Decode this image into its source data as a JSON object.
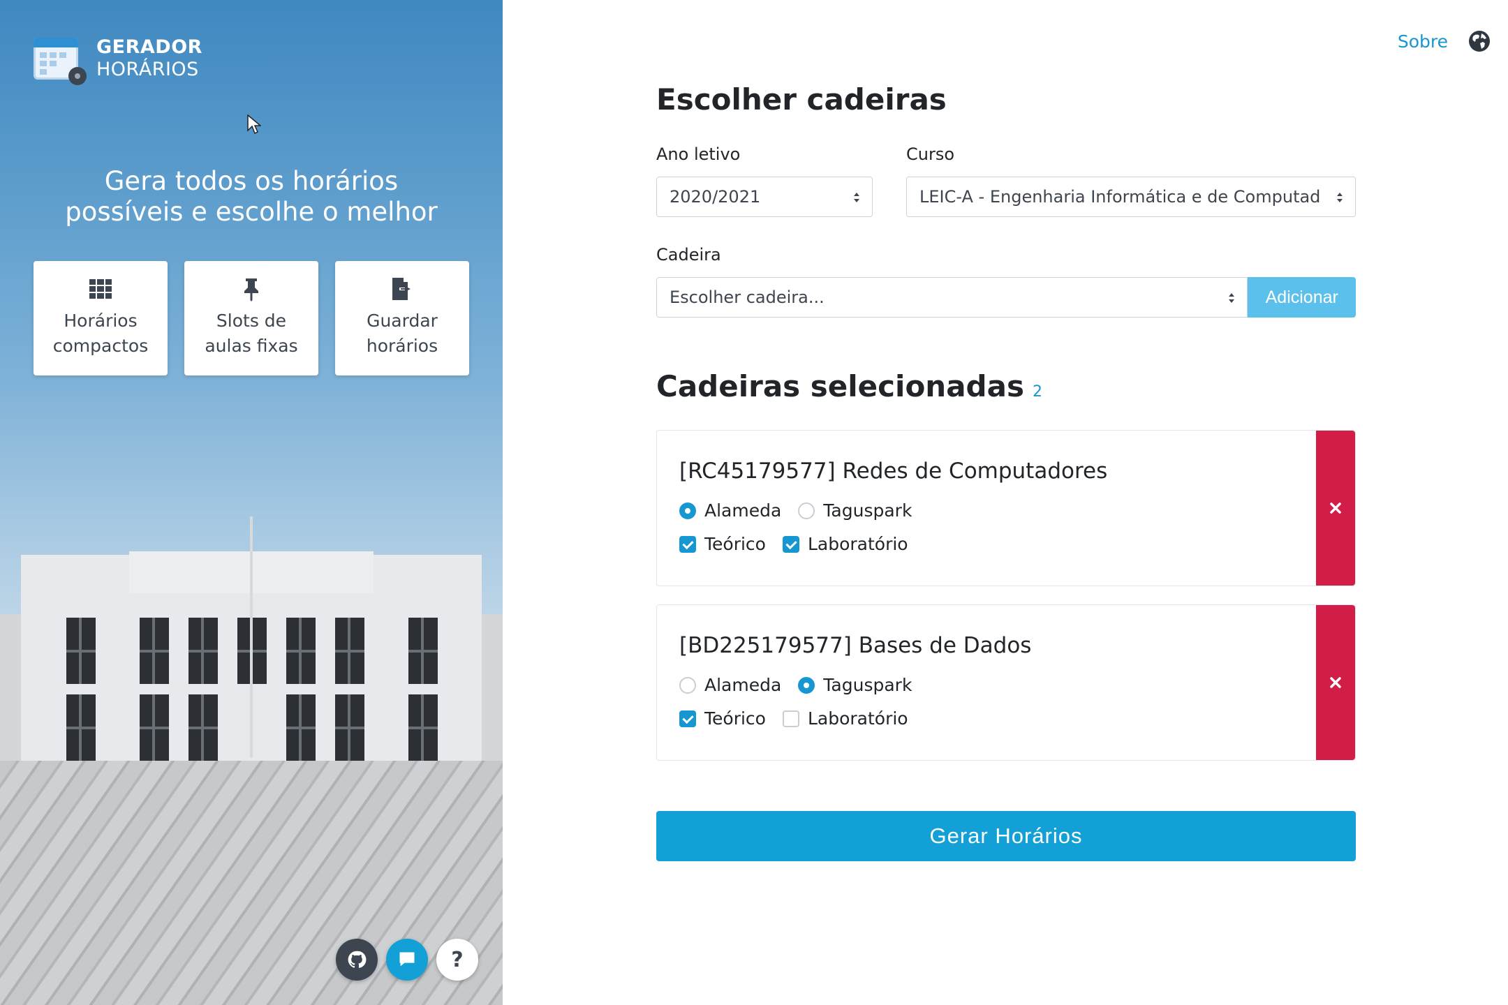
{
  "brand": {
    "line1": "GERADOR",
    "line2": "HORÁRIOS"
  },
  "tagline": {
    "line1": "Gera todos os horários",
    "line2": "possíveis e escolhe o melhor"
  },
  "features": [
    {
      "icon": "grid-icon",
      "line1": "Horários",
      "line2": "compactos"
    },
    {
      "icon": "pin-icon",
      "line1": "Slots de",
      "line2": "aulas fixas"
    },
    {
      "icon": "file-export-icon",
      "line1": "Guardar",
      "line2": "horários"
    }
  ],
  "fabs": {
    "github_icon": "github-icon",
    "chat_icon": "chat-icon",
    "help": "?"
  },
  "topnav": {
    "about": "Sobre",
    "lang_icon": "globe-icon"
  },
  "main": {
    "title": "Escolher cadeiras",
    "ano_label": "Ano letivo",
    "ano_value": "2020/2021",
    "curso_label": "Curso",
    "curso_value": "LEIC-A - Engenharia Informática e de Computad",
    "cadeira_label": "Cadeira",
    "cadeira_placeholder": "Escolher cadeira...",
    "add_button": "Adicionar",
    "selected_title": "Cadeiras selecionadas",
    "selected_count": "2",
    "generate_button": "Gerar Horários"
  },
  "courses": [
    {
      "title": "[RC45179577] Redes de Computadores",
      "campus": [
        {
          "label": "Alameda",
          "checked": true
        },
        {
          "label": "Taguspark",
          "checked": false
        }
      ],
      "types": [
        {
          "label": "Teórico",
          "checked": true
        },
        {
          "label": "Laboratório",
          "checked": true
        }
      ]
    },
    {
      "title": "[BD225179577] Bases de Dados",
      "campus": [
        {
          "label": "Alameda",
          "checked": false
        },
        {
          "label": "Taguspark",
          "checked": true
        }
      ],
      "types": [
        {
          "label": "Teórico",
          "checked": true
        },
        {
          "label": "Laboratório",
          "checked": false
        }
      ]
    }
  ],
  "colors": {
    "accent": "#12a0d7",
    "danger": "#d11d48",
    "add_button": "#5bc0eb",
    "link": "#1797d1"
  }
}
